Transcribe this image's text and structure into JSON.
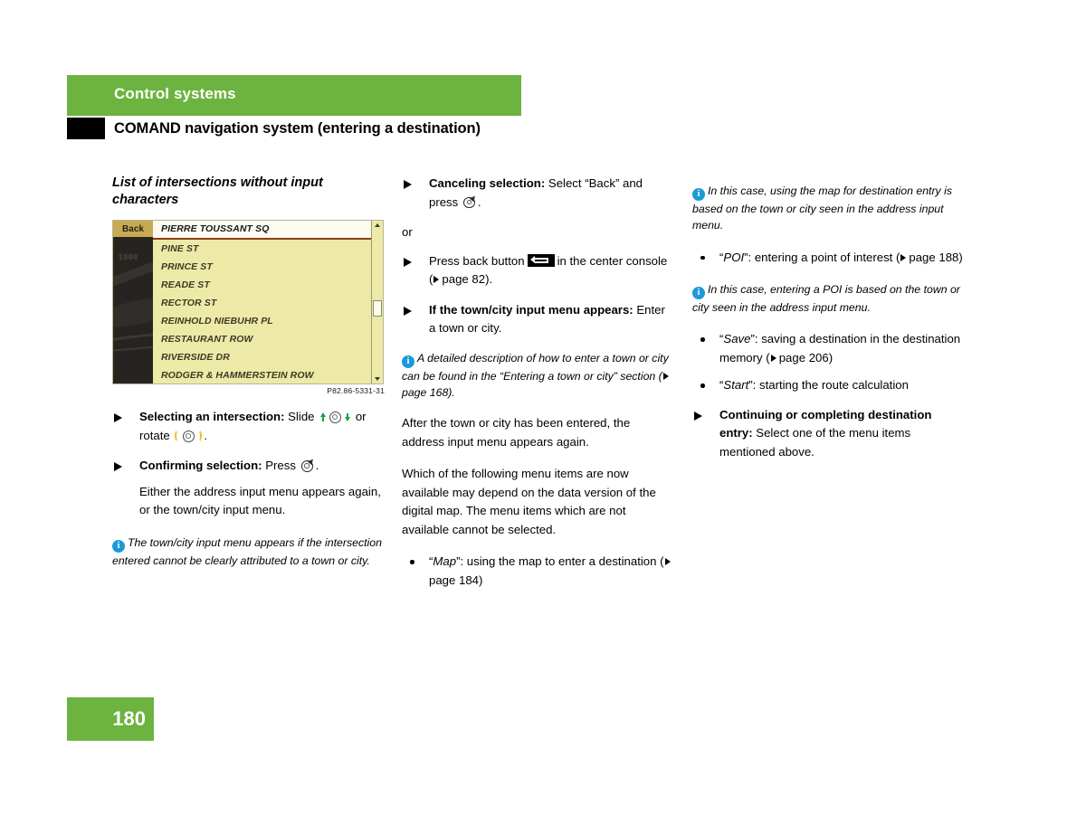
{
  "header": {
    "chapter": "Control systems",
    "subtitle": "COMAND navigation system (entering a destination)"
  },
  "footer": {
    "page_number": "180"
  },
  "colors": {
    "brand_green": "#6cb33f",
    "info_blue": "#1b9ad6",
    "screen_yellow": "#edeaa8",
    "back_button_gold": "#c6ab52",
    "highlight_underline": "#8d3b16",
    "slide_arrow_green": "#18a04a",
    "rotate_bracket_gold": "#f0c020"
  },
  "left_column": {
    "heading": "List of intersections without input characters",
    "figure": {
      "back_button_label": "Back",
      "blurred_map_label": "1000",
      "list_items": [
        "PIERRE TOUSSANT SQ",
        "PINE ST",
        "PRINCE ST",
        "READE ST",
        "RECTOR ST",
        "REINHOLD NIEBUHR PL",
        "RESTAURANT ROW",
        "RIVERSIDE DR",
        "RODGER & HAMMERSTEIN ROW"
      ],
      "selected_index": 0,
      "caption": "P82.86-5331-31"
    },
    "steps": [
      {
        "bold": "Selecting an intersection:",
        "text_before_slide": " Slide ",
        "text_between": " or rotate ",
        "text_after": "."
      },
      {
        "bold": "Confirming selection:",
        "text": " Press ",
        "after": "."
      }
    ],
    "paragraph": "Either the address input menu appears again, or the town/city input menu.",
    "note": "The town/city input menu appears if the intersection entered cannot be clearly attributed to a town or city."
  },
  "middle_column": {
    "step_cancel": {
      "bold": "Canceling selection:",
      "text": " Select “Back” and press ",
      "quoted": "Back",
      "after": "."
    },
    "or_label": "or",
    "step_back_button": {
      "text_before": "Press back button",
      "text_after": "in the center console (",
      "page_ref": "page 82",
      "close": ")."
    },
    "step_town_menu": {
      "bold": "If the town/city input menu appears:",
      "text": " Enter a town or city."
    },
    "note_detailed": {
      "text_1": "A detailed description of how to enter a town or city can be found in the “Entering a town or city” section (",
      "page_ref": "page 168",
      "text_2": ")."
    },
    "paragraph_1": "After the town or city has been entered, the address input menu appears again.",
    "paragraph_2": "Which of the following menu items are now available may depend on the data version of the digital map. The menu items which are not available cannot be selected.",
    "bullet_map": {
      "quote": "Map",
      "text": "”: using the map to enter a destination (",
      "page_ref": "page 184",
      "close": ")"
    }
  },
  "right_column": {
    "note_map": "In this case, using the map for destination entry is based on the town or city seen in the address input menu.",
    "bullet_poi": {
      "quote": "POI",
      "text": "”: entering a point of interest (",
      "page_ref": "page 188",
      "close": ")"
    },
    "note_poi": "In this case, entering a POI is based on the town or city seen in the address input menu.",
    "bullet_save": {
      "quote": "Save",
      "text": "”: saving a destination in the destination memory (",
      "page_ref": "page 206",
      "close": ")"
    },
    "bullet_start": {
      "quote": "Start",
      "text": "”: starting the route calculation"
    },
    "step_continue": {
      "bold": "Continuing or completing destination entry:",
      "text": " Select one of the menu items mentioned above."
    }
  }
}
